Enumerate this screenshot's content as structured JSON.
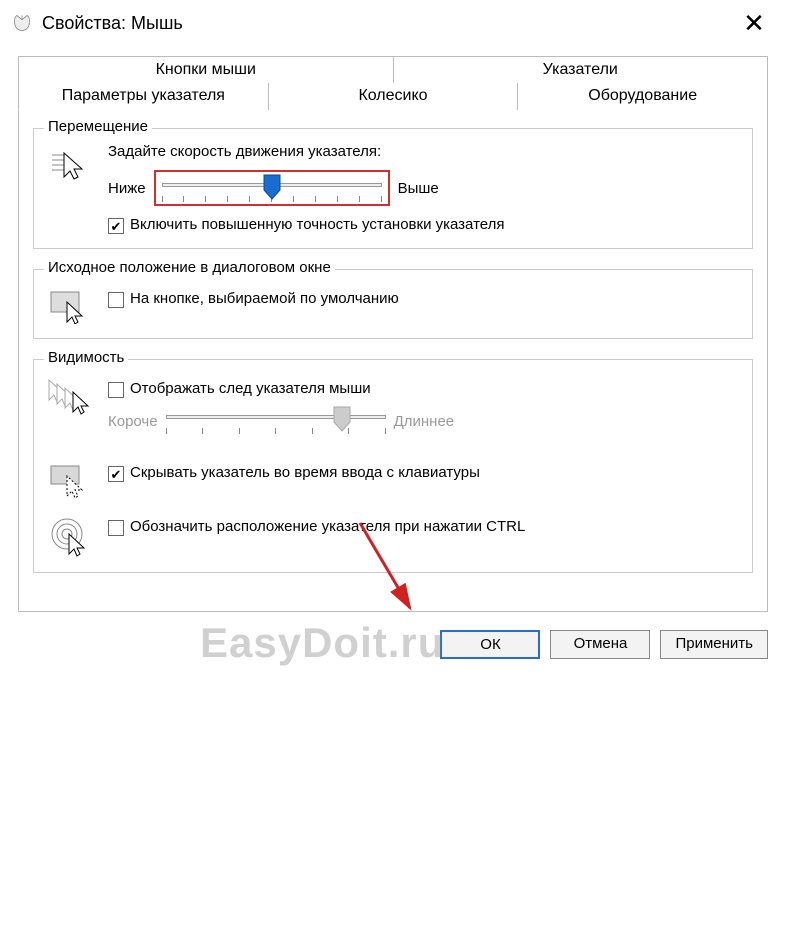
{
  "window": {
    "title": "Свойства: Мышь"
  },
  "tabs": {
    "row1": [
      "Кнопки мыши",
      "Указатели"
    ],
    "row2": [
      "Параметры указателя",
      "Колесико",
      "Оборудование"
    ],
    "active": "Параметры указателя"
  },
  "groups": {
    "motion": {
      "legend": "Перемещение",
      "label": "Задайте скорость движения указателя:",
      "low": "Ниже",
      "high": "Выше",
      "slider_pos_pct": 50,
      "precision_checked": true,
      "precision_label": "Включить повышенную точность установки указателя"
    },
    "snap": {
      "legend": "Исходное положение в диалоговом окне",
      "checked": false,
      "label": "На кнопке, выбираемой по умолчанию"
    },
    "visibility": {
      "legend": "Видимость",
      "trails": {
        "checked": false,
        "label": "Отображать след указателя мыши",
        "short": "Короче",
        "long": "Длиннее",
        "slider_pos_pct": 80
      },
      "hide": {
        "checked": true,
        "label": "Скрывать указатель во время ввода с клавиатуры"
      },
      "ctrl": {
        "checked": false,
        "label": "Обозначить расположение указателя при нажатии CTRL"
      }
    }
  },
  "buttons": {
    "ok": "ОК",
    "cancel": "Отмена",
    "apply": "Применить"
  },
  "watermark": "EasyDoit.ru"
}
